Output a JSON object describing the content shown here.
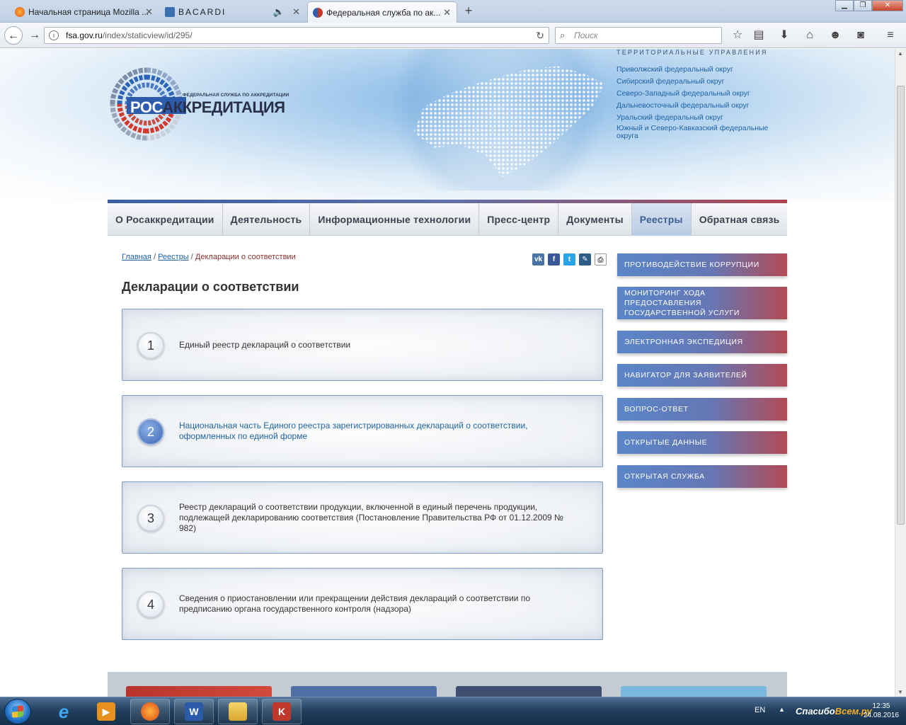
{
  "browser": {
    "tabs": [
      {
        "title": "Начальная страница Mozilla ...",
        "icon": "firefox-icon"
      },
      {
        "title": "BACARDI",
        "icon": "video-icon"
      },
      {
        "title": "Федеральная служба по ак...",
        "icon": "fsa-icon"
      }
    ],
    "url_host": "fsa.gov.ru",
    "url_path": "/index/staticview/id/295/",
    "search_placeholder": "Поиск"
  },
  "site": {
    "agency_caption": "ФЕДЕРАЛЬНАЯ СЛУЖБА ПО АККРЕДИТАЦИИ",
    "brand_prefix": "РОС",
    "brand_rest": "АККРЕДИТАЦИЯ",
    "territories_heading": "ТЕРРИТОРИАЛЬНЫЕ УПРАВЛЕНИЯ",
    "territories": [
      "Приволжский федеральный округ",
      "Сибирский федеральный округ",
      "Северо-Западный федеральный округ",
      "Дальневосточный федеральный округ",
      "Уральский федеральный округ",
      "Южный и Северо-Кавказский федеральные округа"
    ],
    "menu": [
      "О Росаккредитации",
      "Деятельность",
      "Информационные технологии",
      "Пресс-центр",
      "Документы",
      "Реестры",
      "Обратная связь"
    ],
    "active_menu": "Реестры"
  },
  "breadcrumb": {
    "home": "Главная",
    "section": "Реестры",
    "current": "Декларации о соответствии",
    "separator": "/"
  },
  "page_title": "Декларации о соответствии",
  "cards": [
    {
      "num": "1",
      "text": "Единый реестр деклараций о соответствии"
    },
    {
      "num": "2",
      "text": "Национальная часть Единого реестра зарегистрированных деклараций о соответствии, оформленных по единой форме"
    },
    {
      "num": "3",
      "text": "Реестр деклараций о соответствии продукции, включенной в единый перечень продукции, подлежащей декларированию соответствия (Постановление Правительства РФ от 01.12.2009 № 982)"
    },
    {
      "num": "4",
      "text": "Сведения о приостановлении или прекращении действия деклараций о соответствии по предписанию органа государственного контроля (надзора)"
    }
  ],
  "sidebar": [
    "ПРОТИВОДЕЙСТВИЕ КОРРУПЦИИ",
    "МОНИТОРИНГ ХОДА ПРЕДОСТАВЛЕНИЯ ГОСУДАРСТВЕННОЙ УСЛУГИ",
    "ЭЛЕКТРОННАЯ ЭКСПЕДИЦИЯ",
    "НАВИГАТОР ДЛЯ ЗАЯВИТЕЛЕЙ",
    "ВОПРОС-ОТВЕТ",
    "ОТКРЫТЫЕ ДАННЫЕ",
    "ОТКРЫТАЯ СЛУЖБА"
  ],
  "share": [
    "vk",
    "f",
    "t",
    "livejournal",
    "print"
  ],
  "taskbar": {
    "lang": "EN",
    "time": "12:35",
    "date": "24.08.2016",
    "watermark_a": "Спасибо",
    "watermark_b": "Всем.ру"
  },
  "colors": {
    "link": "#1f63a7",
    "accent_blue": "#5a86c9",
    "accent_red": "#b34a55"
  }
}
